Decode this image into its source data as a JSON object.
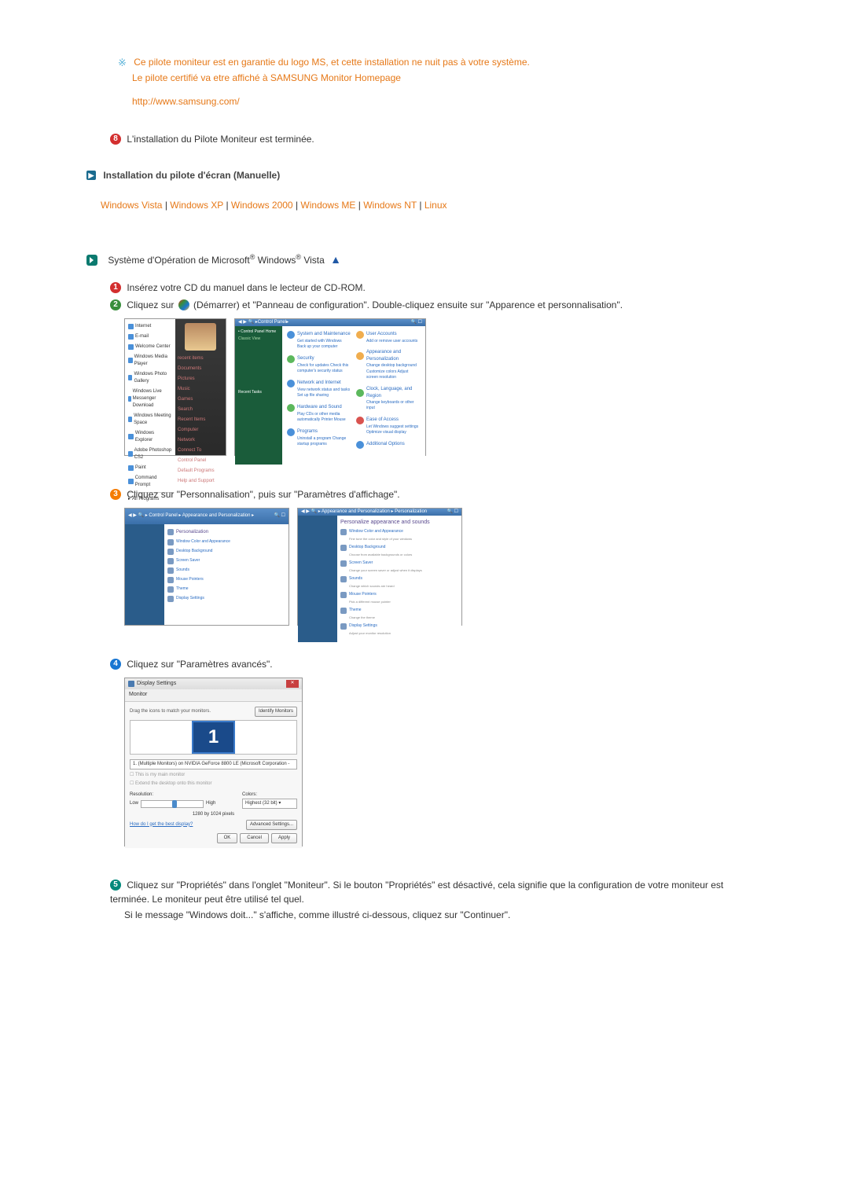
{
  "note": {
    "line1": "Ce pilote moniteur est en garantie du logo MS, et cette installation ne nuit pas à votre système.",
    "line2": "Le pilote certifié va etre affiché à SAMSUNG Monitor Homepage",
    "url": "http://www.samsung.com/"
  },
  "step8": {
    "num": "8",
    "text": "L'installation du Pilote Moniteur est terminée."
  },
  "section_heading": "Installation du pilote d'écran (Manuelle)",
  "os_links": {
    "vista": "Windows Vista",
    "xp": "Windows XP",
    "w2000": "Windows 2000",
    "me": "Windows ME",
    "nt": "Windows NT",
    "linux": "Linux"
  },
  "vista_title": {
    "pre": "Système d'Opération de Microsoft",
    "mid": " Windows",
    "post": " Vista"
  },
  "steps": {
    "s1": {
      "num": "1",
      "text": "Insérez votre CD du manuel dans le lecteur de CD-ROM."
    },
    "s2": {
      "num": "2",
      "text_pre": "Cliquez sur ",
      "text_mid": "(Démarrer) et \"Panneau de configuration\". Double-cliquez ensuite sur \"Apparence et personnalisation\"."
    },
    "s3": {
      "num": "3",
      "text": "Cliquez sur \"Personnalisation\", puis sur \"Paramètres d'affichage\"."
    },
    "s4": {
      "num": "4",
      "text": "Cliquez sur \"Paramètres avancés\"."
    },
    "s5": {
      "num": "5",
      "text": "Cliquez sur \"Propriétés\" dans l'onglet \"Moniteur\". Si le bouton \"Propriétés\" est désactivé, cela signifie que la configuration de votre moniteur est terminée. Le moniteur peut être utilisé tel quel.",
      "text2": "Si le message \"Windows doit...\" s'affiche, comme illustré ci-dessous, cliquez sur \"Continuer\"."
    }
  },
  "startmenu": {
    "items": [
      "Internet",
      "E-mail",
      "Welcome Center",
      "Windows Media Player",
      "Windows Photo Gallery",
      "Windows Live Messenger Download",
      "Windows Meeting Space",
      "Windows Explorer",
      "Adobe Photoshop CS2",
      "Paint",
      "Command Prompt",
      "All Programs"
    ],
    "right": [
      "recent items",
      "Documents",
      "Pictures",
      "Music",
      "Games",
      "Search",
      "Recent Items",
      "Computer",
      "Network",
      "Connect To",
      "Control Panel",
      "Default Programs",
      "Help and Support"
    ]
  },
  "controlpanel": {
    "header": "Control Panel",
    "sidebar": [
      "Control Panel Home",
      "Classic View"
    ],
    "sidebar_tasks": "Recent Tasks",
    "cats": [
      {
        "title": "System and Maintenance",
        "sub": "Get started with Windows\nBack up your computer"
      },
      {
        "title": "User Accounts",
        "sub": "Add or remove user accounts"
      },
      {
        "title": "Security",
        "sub": "Check for updates\nCheck this computer's security status"
      },
      {
        "title": "Appearance and Personalization",
        "sub": "Change desktop background\nCustomize colors\nAdjust screen resolution"
      },
      {
        "title": "Network and Internet",
        "sub": "View network status and tasks\nSet up file sharing"
      },
      {
        "title": "Clock, Language, and Region",
        "sub": "Change keyboards or other input"
      },
      {
        "title": "Hardware and Sound",
        "sub": "Play CDs or other media automatically\nPrinter\nMouse"
      },
      {
        "title": "Ease of Access",
        "sub": "Let Windows suggest settings\nOptimize visual display"
      },
      {
        "title": "Programs",
        "sub": "Uninstall a program\nChange startup programs"
      },
      {
        "title": "Additional Options",
        "sub": ""
      }
    ]
  },
  "personalize1": {
    "title": "Personalization",
    "items": [
      {
        "label": "Window Color and Appearance"
      },
      {
        "label": "Desktop Background"
      },
      {
        "label": "Screen Saver"
      },
      {
        "label": "Sounds"
      },
      {
        "label": "Mouse Pointers"
      },
      {
        "label": "Theme"
      },
      {
        "label": "Display Settings"
      }
    ]
  },
  "personalize2": {
    "title": "Personalize appearance and sounds",
    "items": [
      {
        "label": "Window Color and Appearance"
      },
      {
        "label": "Desktop Background"
      },
      {
        "label": "Screen Saver"
      },
      {
        "label": "Sounds"
      },
      {
        "label": "Mouse Pointers"
      },
      {
        "label": "Theme"
      },
      {
        "label": "Display Settings"
      }
    ]
  },
  "displaysettings": {
    "title": "Display Settings",
    "tab": "Monitor",
    "desc": "Drag the icons to match your monitors.",
    "identify": "Identify Monitors",
    "monitor_num": "1",
    "dropdown": "1. (Multiple Monitors) on NVIDIA GeForce 8800 LE (Microsoft Corporation - ",
    "check1": "This is my main monitor",
    "check2": "Extend the desktop onto this monitor",
    "res_label": "Resolution:",
    "low": "Low",
    "high": "High",
    "res_value": "1280 by 1024 pixels",
    "color_label": "Colors:",
    "color_value": "Highest (32 bit)",
    "help_link": "How do I get the best display?",
    "adv_btn": "Advanced Settings...",
    "ok": "OK",
    "cancel": "Cancel",
    "apply": "Apply"
  }
}
